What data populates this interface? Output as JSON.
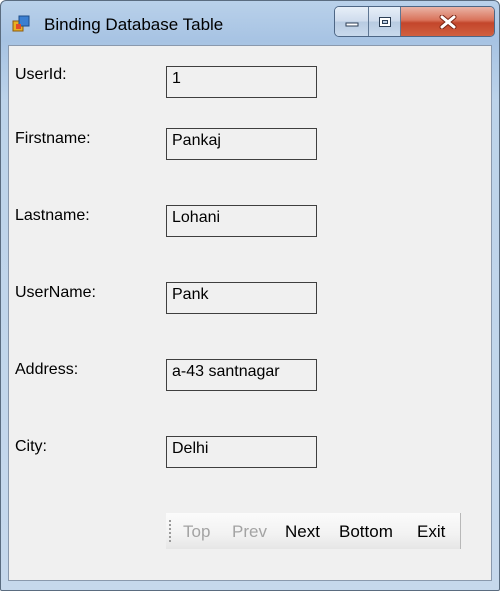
{
  "window": {
    "title": "Binding Database Table",
    "icon": "form-app-icon",
    "controls": [
      "minimize-icon",
      "maximize-icon",
      "close-icon"
    ]
  },
  "fields": [
    {
      "label": "UserId:",
      "value": "1"
    },
    {
      "label": "Firstname:",
      "value": "Pankaj"
    },
    {
      "label": "Lastname:",
      "value": "Lohani"
    },
    {
      "label": "UserName:",
      "value": "Pank"
    },
    {
      "label": "Address:",
      "value": "a-43 santnagar"
    },
    {
      "label": "City:",
      "value": "Delhi"
    }
  ],
  "navigator": {
    "buttons": [
      {
        "label": "Top",
        "enabled": false
      },
      {
        "label": "Prev",
        "enabled": false
      },
      {
        "label": "Next",
        "enabled": true
      },
      {
        "label": "Bottom",
        "enabled": true
      },
      {
        "label": "Exit",
        "enabled": true
      }
    ]
  },
  "colors": {
    "close_button": "#c3462b",
    "titlebar": "#b9d1ea",
    "client_bg": "#f0f0f0",
    "disabled_text": "#a3a3a3"
  }
}
